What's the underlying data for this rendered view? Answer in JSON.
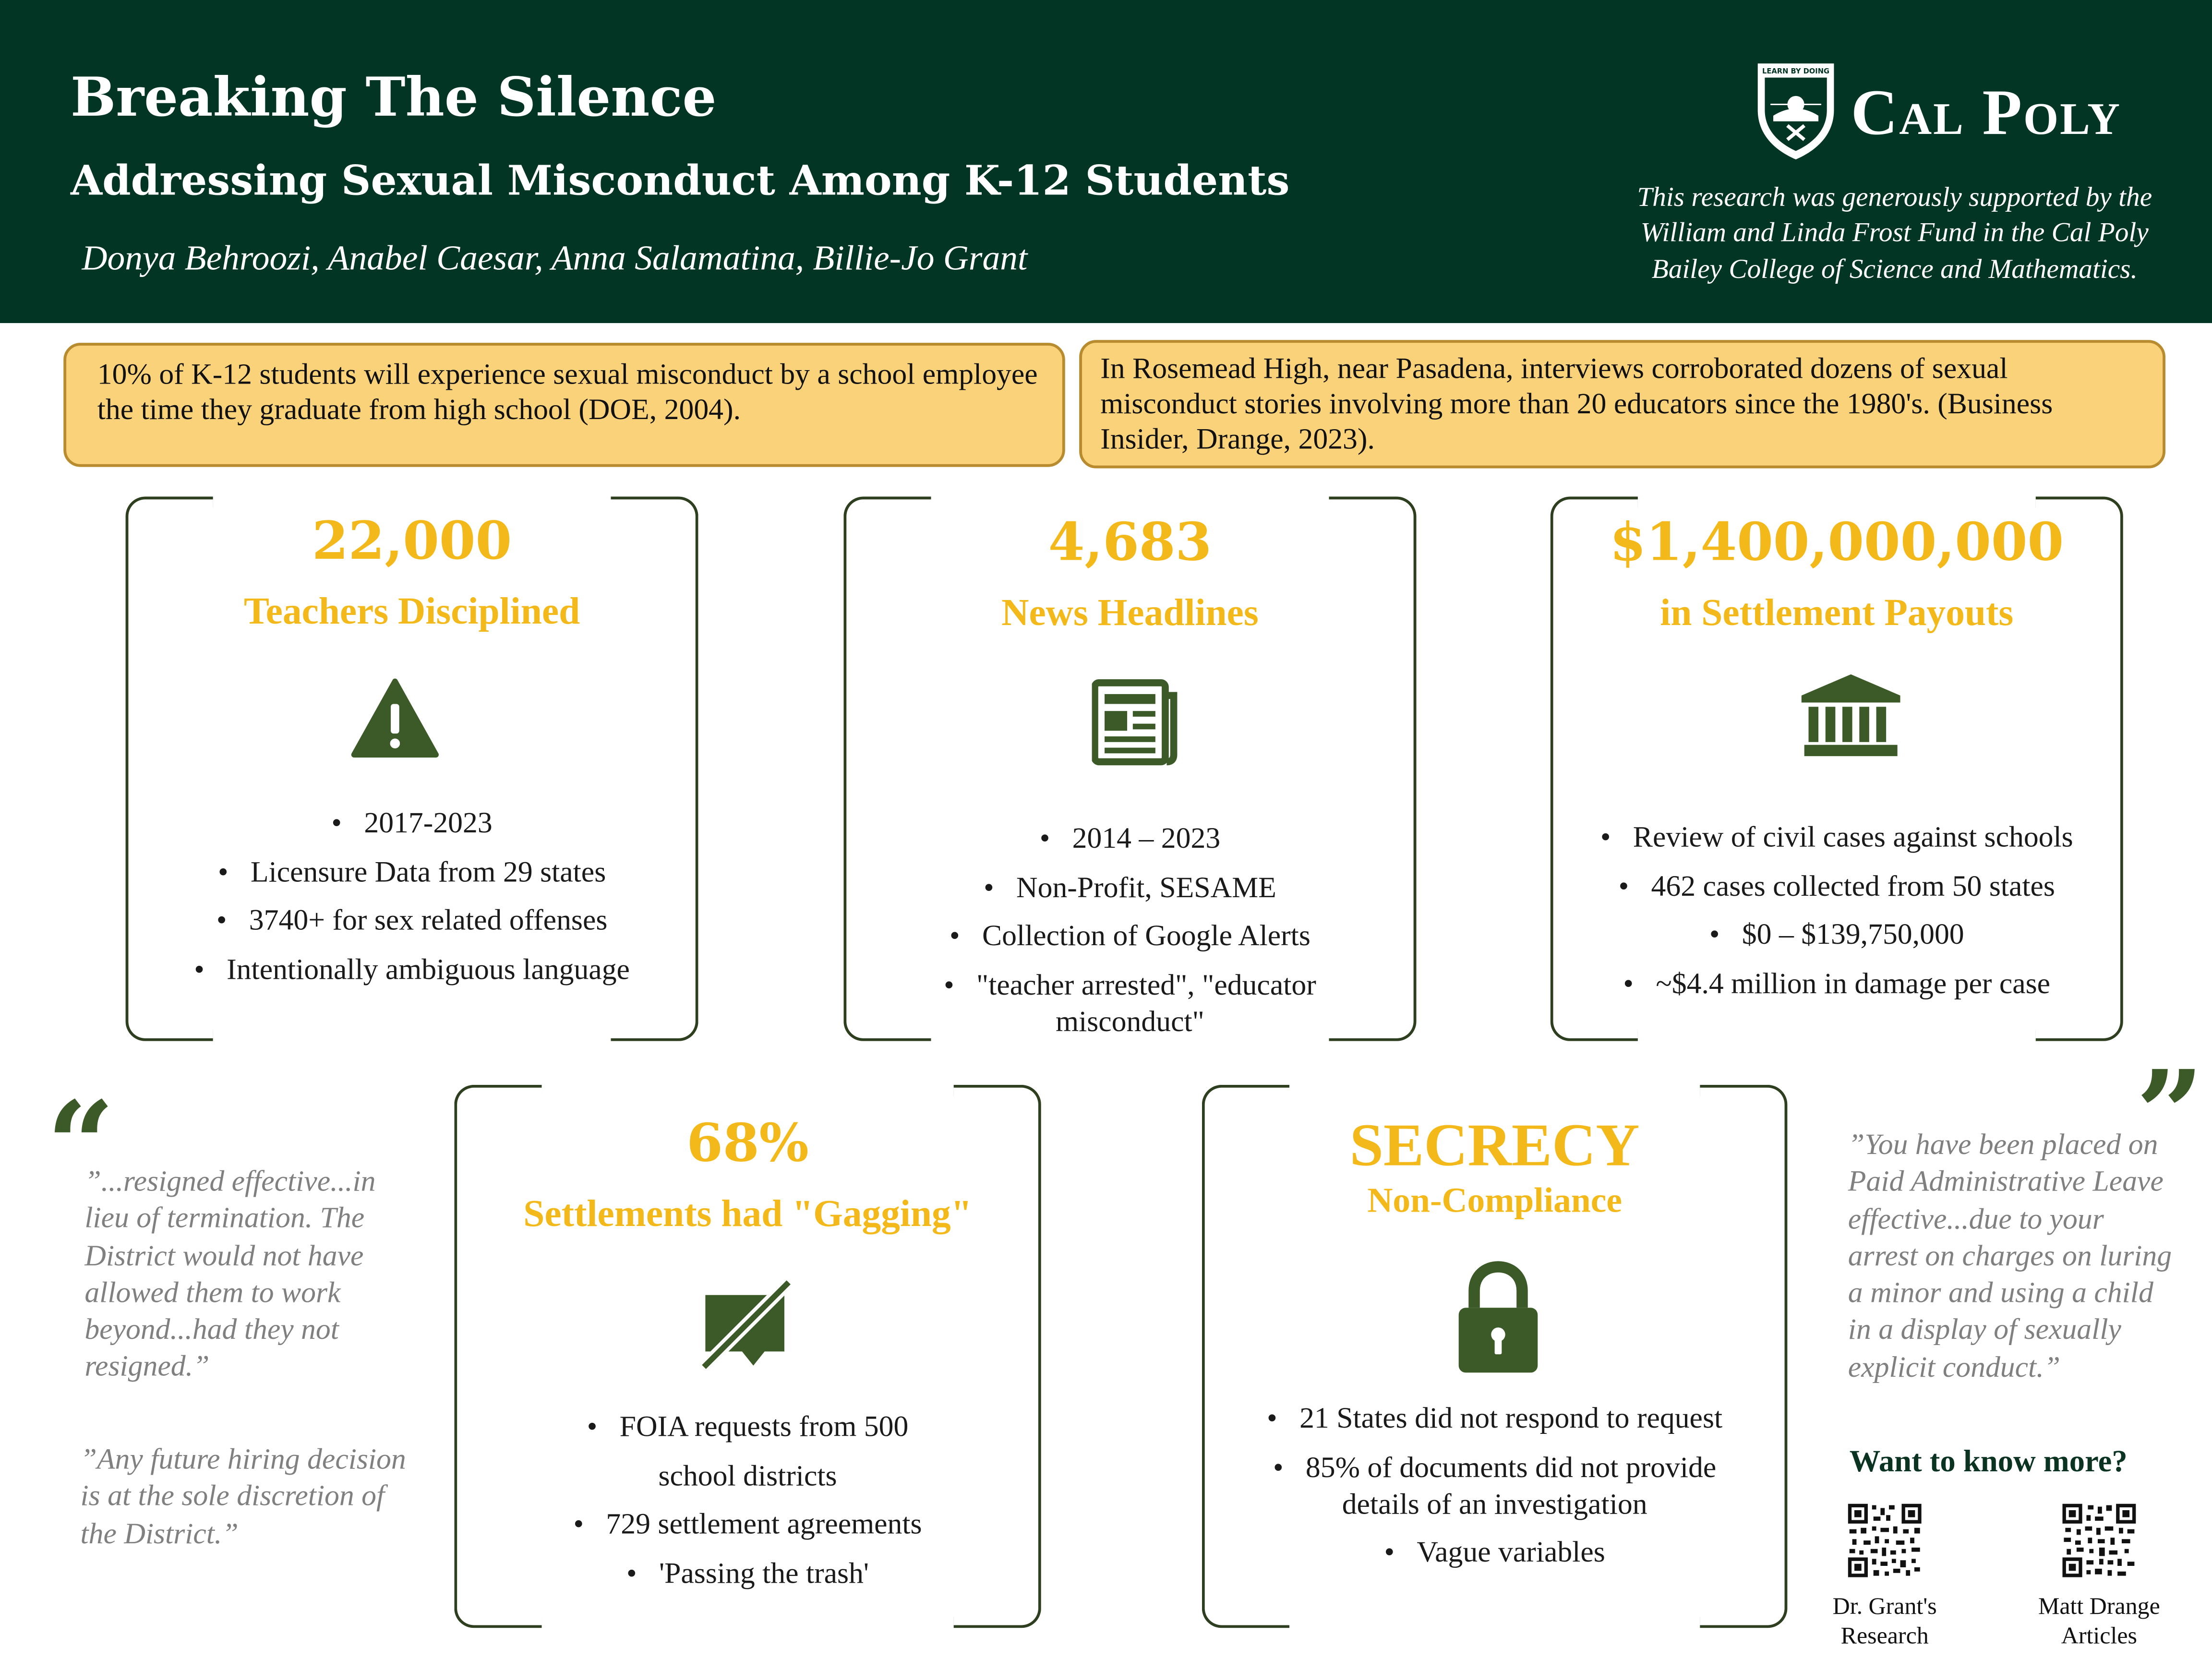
{
  "header": {
    "title": "Breaking The Silence",
    "subtitle": "Addressing Sexual Misconduct Among K-12 Students",
    "authors": "Donya Behroozi, Anabel Caesar, Anna Salamatina, Billie-Jo Grant",
    "logo_text": "Cal Poly",
    "logo_motto": "LEARN BY DOING",
    "support": [
      "This research was generously supported by the",
      "William and Linda Frost Fund in the Cal Poly",
      "Bailey College of Science and Mathematics."
    ]
  },
  "callouts": [
    {
      "text": "10% of K-12 students will experience sexual misconduct by a school employee the time they graduate from high school (DOE, 2004)."
    },
    {
      "text": "In Rosemead High, near Pasadena, interviews corroborated dozens of sexual misconduct stories involving more than 20 educators since the 1980's. (Business Insider, Drange, 2023)."
    }
  ],
  "panels": {
    "teachers": {
      "stat": "22,000",
      "label": "Teachers Disciplined",
      "icon": "warning-icon",
      "bullets": [
        "2017-2023",
        "Licensure Data from 29 states",
        "3740+ for sex related offenses",
        "Intentionally ambiguous language"
      ]
    },
    "news": {
      "stat": "4,683",
      "label": "News Headlines",
      "icon": "newspaper-icon",
      "bullets": [
        "2014 – 2023",
        "Non-Profit, SESAME",
        "Collection of Google Alerts",
        "\"teacher arrested\", \"educator misconduct\""
      ]
    },
    "settlements": {
      "stat": "$1,400,000,000",
      "label": "in Settlement Payouts",
      "icon": "bank-icon",
      "bullets": [
        "Review of civil cases against schools",
        "462 cases collected from 50 states",
        "$0 – $139,750,000",
        "~$4.4 million in damage per case"
      ]
    },
    "gagging": {
      "stat": "68%",
      "label": "Settlements had \"Gagging\"",
      "icon": "muted-chat-icon",
      "bullets": [
        "FOIA requests from 500 school districts",
        "729 settlement agreements",
        "'Passing the trash'"
      ]
    },
    "secrecy": {
      "stat": "SECRECY",
      "label": "Non-Compliance",
      "icon": "lock-icon",
      "bullets": [
        "21 States did not respond to request",
        "85% of documents did not provide details of an investigation",
        "Vague variables"
      ]
    }
  },
  "quotes": {
    "open_mark": "“",
    "close_mark": "”",
    "left_1": "”...resigned effective...in lieu of termination. The District would not have allowed them to work beyond...had they not resigned.”",
    "left_2": "”Any future hiring decision is at the sole discretion of the District.”",
    "right_1": "”You have been placed on Paid Administrative Leave effective...due to your arrest on charges on luring a minor and using a child in a display of sexually explicit conduct.”"
  },
  "more": {
    "heading": "Want to know more?",
    "links": [
      {
        "label_1": "Dr. Grant's",
        "label_2": "Research"
      },
      {
        "label_1": "Matt Drange",
        "label_2": "Articles"
      }
    ]
  },
  "colors": {
    "header_bg": "#023524",
    "accent_gold": "#f3b91b",
    "callout_bg": "#fad27a",
    "icon_green": "#3b5a27"
  }
}
